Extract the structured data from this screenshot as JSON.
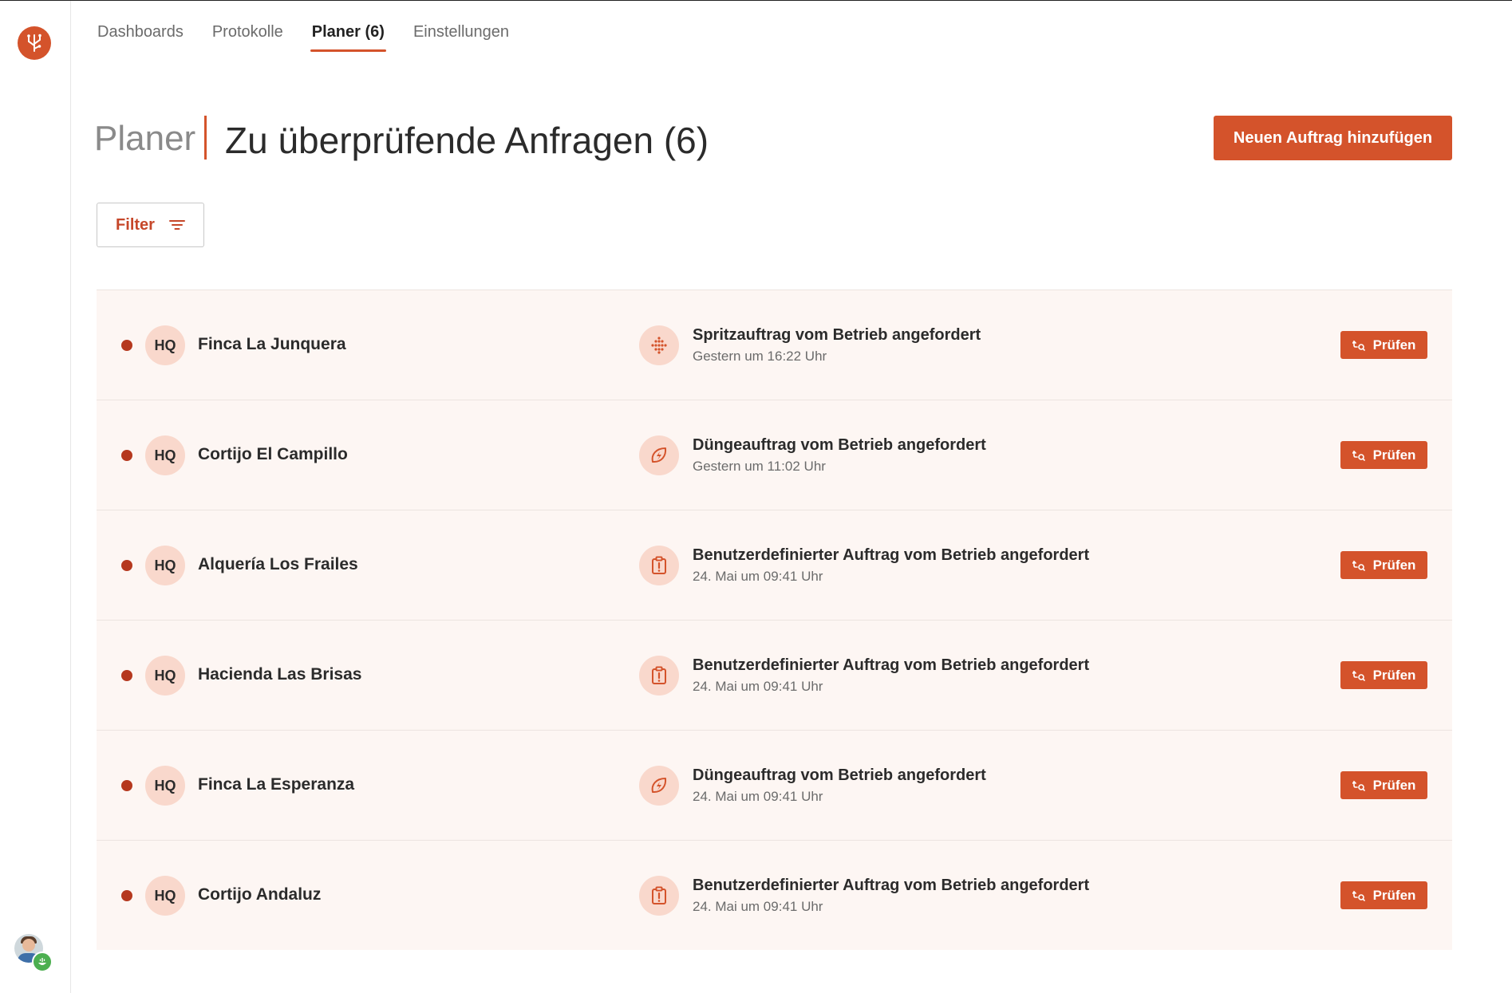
{
  "nav": {
    "tabs": [
      {
        "label": "Dashboards"
      },
      {
        "label": "Protokolle"
      },
      {
        "label": "Planer (6)"
      },
      {
        "label": "Einstellungen"
      }
    ],
    "active_tab": "Planer (6)"
  },
  "header": {
    "section": "Planer",
    "title": "Zu überprüfende Anfragen (6)",
    "add_button": "Neuen Auftrag hinzufügen"
  },
  "filter": {
    "label": "Filter"
  },
  "requests": [
    {
      "badge": "HQ",
      "farm": "Finca La Junquera",
      "icon": "spray-icon",
      "title": "Spritzauftrag vom Betrieb angefordert",
      "time": "Gestern um 16:22 Uhr",
      "action": "Prüfen"
    },
    {
      "badge": "HQ",
      "farm": "Cortijo El Campillo",
      "icon": "fertilizer-icon",
      "title": "Düngeauftrag vom Betrieb angefordert",
      "time": "Gestern um 11:02 Uhr",
      "action": "Prüfen"
    },
    {
      "badge": "HQ",
      "farm": "Alquería Los Frailes",
      "icon": "custom-task-icon",
      "title": "Benutzerdefinierter Auftrag vom Betrieb angefordert",
      "time": "24. Mai um 09:41 Uhr",
      "action": "Prüfen"
    },
    {
      "badge": "HQ",
      "farm": "Hacienda Las Brisas",
      "icon": "custom-task-icon",
      "title": "Benutzerdefinierter Auftrag vom Betrieb angefordert",
      "time": "24. Mai um 09:41 Uhr",
      "action": "Prüfen"
    },
    {
      "badge": "HQ",
      "farm": "Finca La Esperanza",
      "icon": "fertilizer-icon",
      "title": "Düngeauftrag vom Betrieb angefordert",
      "time": "24. Mai um 09:41 Uhr",
      "action": "Prüfen"
    },
    {
      "badge": "HQ",
      "farm": "Cortijo Andaluz",
      "icon": "custom-task-icon",
      "title": "Benutzerdefinierter Auftrag vom Betrieb angefordert",
      "time": "24. Mai um 09:41 Uhr",
      "action": "Prüfen"
    }
  ],
  "colors": {
    "accent": "#d4532b",
    "unread_dot": "#b5381e",
    "row_background": "#fdf6f3",
    "icon_background": "#f9d8cc"
  }
}
